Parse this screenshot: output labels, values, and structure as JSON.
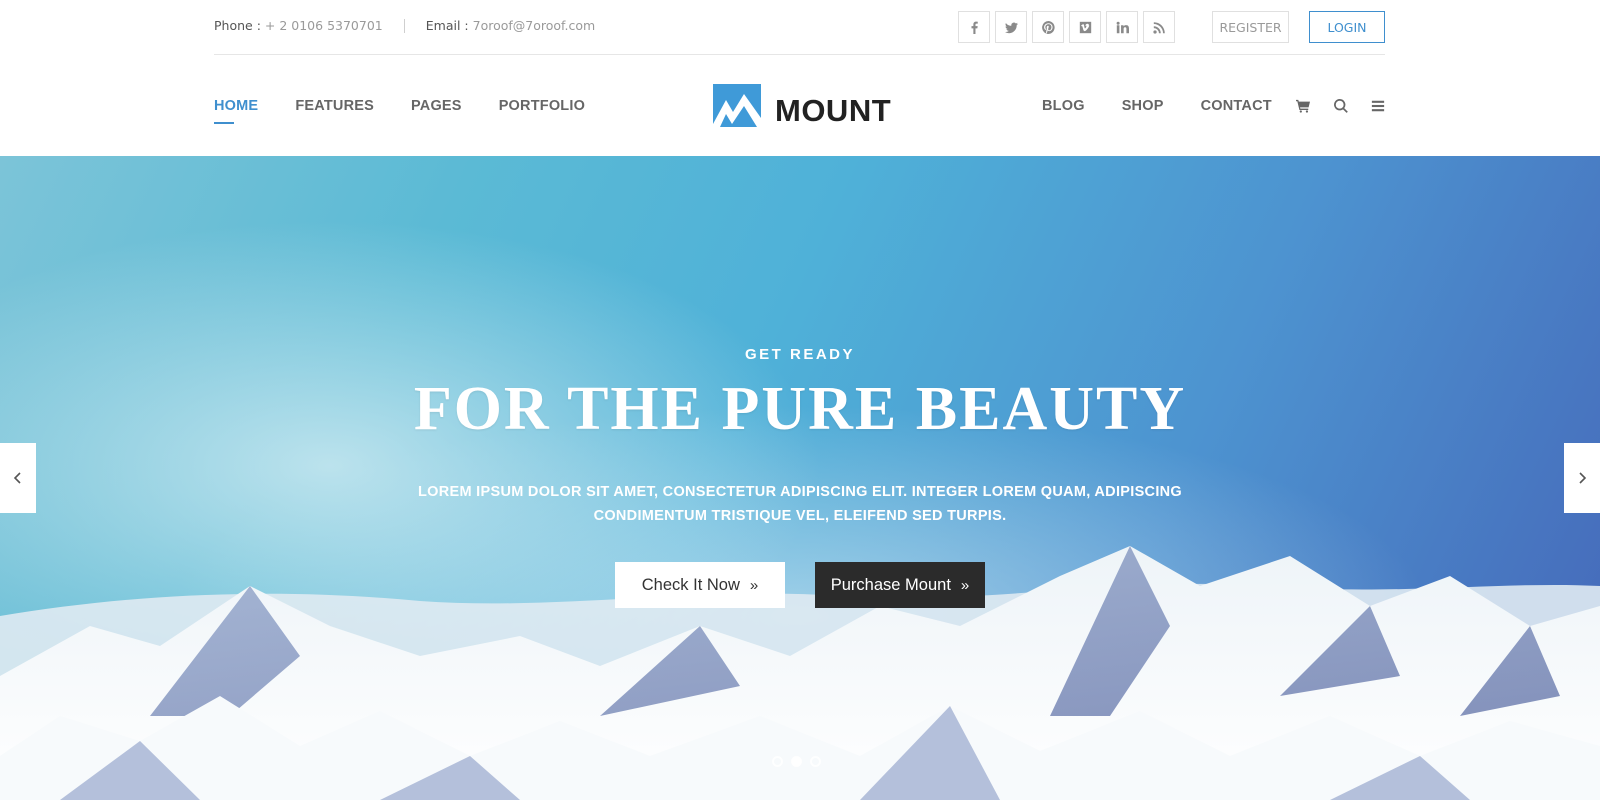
{
  "topbar": {
    "phone_label": "Phone :",
    "phone_value": "+ 2 0106 5370701",
    "email_label": "Email :",
    "email_value": "7oroof@7oroof.com",
    "social_icons": [
      "facebook-icon",
      "twitter-icon",
      "pinterest-icon",
      "vimeo-icon",
      "linkedin-icon",
      "rss-icon"
    ],
    "register_label": "REGISTER",
    "login_label": "LOGIN"
  },
  "nav": {
    "left_items": [
      "HOME",
      "FEATURES",
      "PAGES",
      "PORTFOLIO"
    ],
    "right_items": [
      "BLOG",
      "SHOP",
      "CONTACT"
    ],
    "active_item": "HOME",
    "icons": [
      "cart-icon",
      "search-icon",
      "menu-icon"
    ],
    "logo_text": "MOUNT"
  },
  "hero": {
    "kicker": "GET READY",
    "title": "FOR THE PURE BEAUTY",
    "description": "LOREM IPSUM DOLOR SIT AMET, CONSECTETUR ADIPISCING ELIT. INTEGER LOREM QUAM, ADIPISCING CONDIMENTUM TRISTIQUE VEL, ELEIFEND SED TURPIS.",
    "primary_button": "Check It Now",
    "secondary_button": "Purchase Mount",
    "slide_count": 3,
    "active_slide": 2
  },
  "colors": {
    "accent": "#3f8fce",
    "dark_button": "#2b2b2b",
    "logo_blue": "#3f9ad8"
  }
}
